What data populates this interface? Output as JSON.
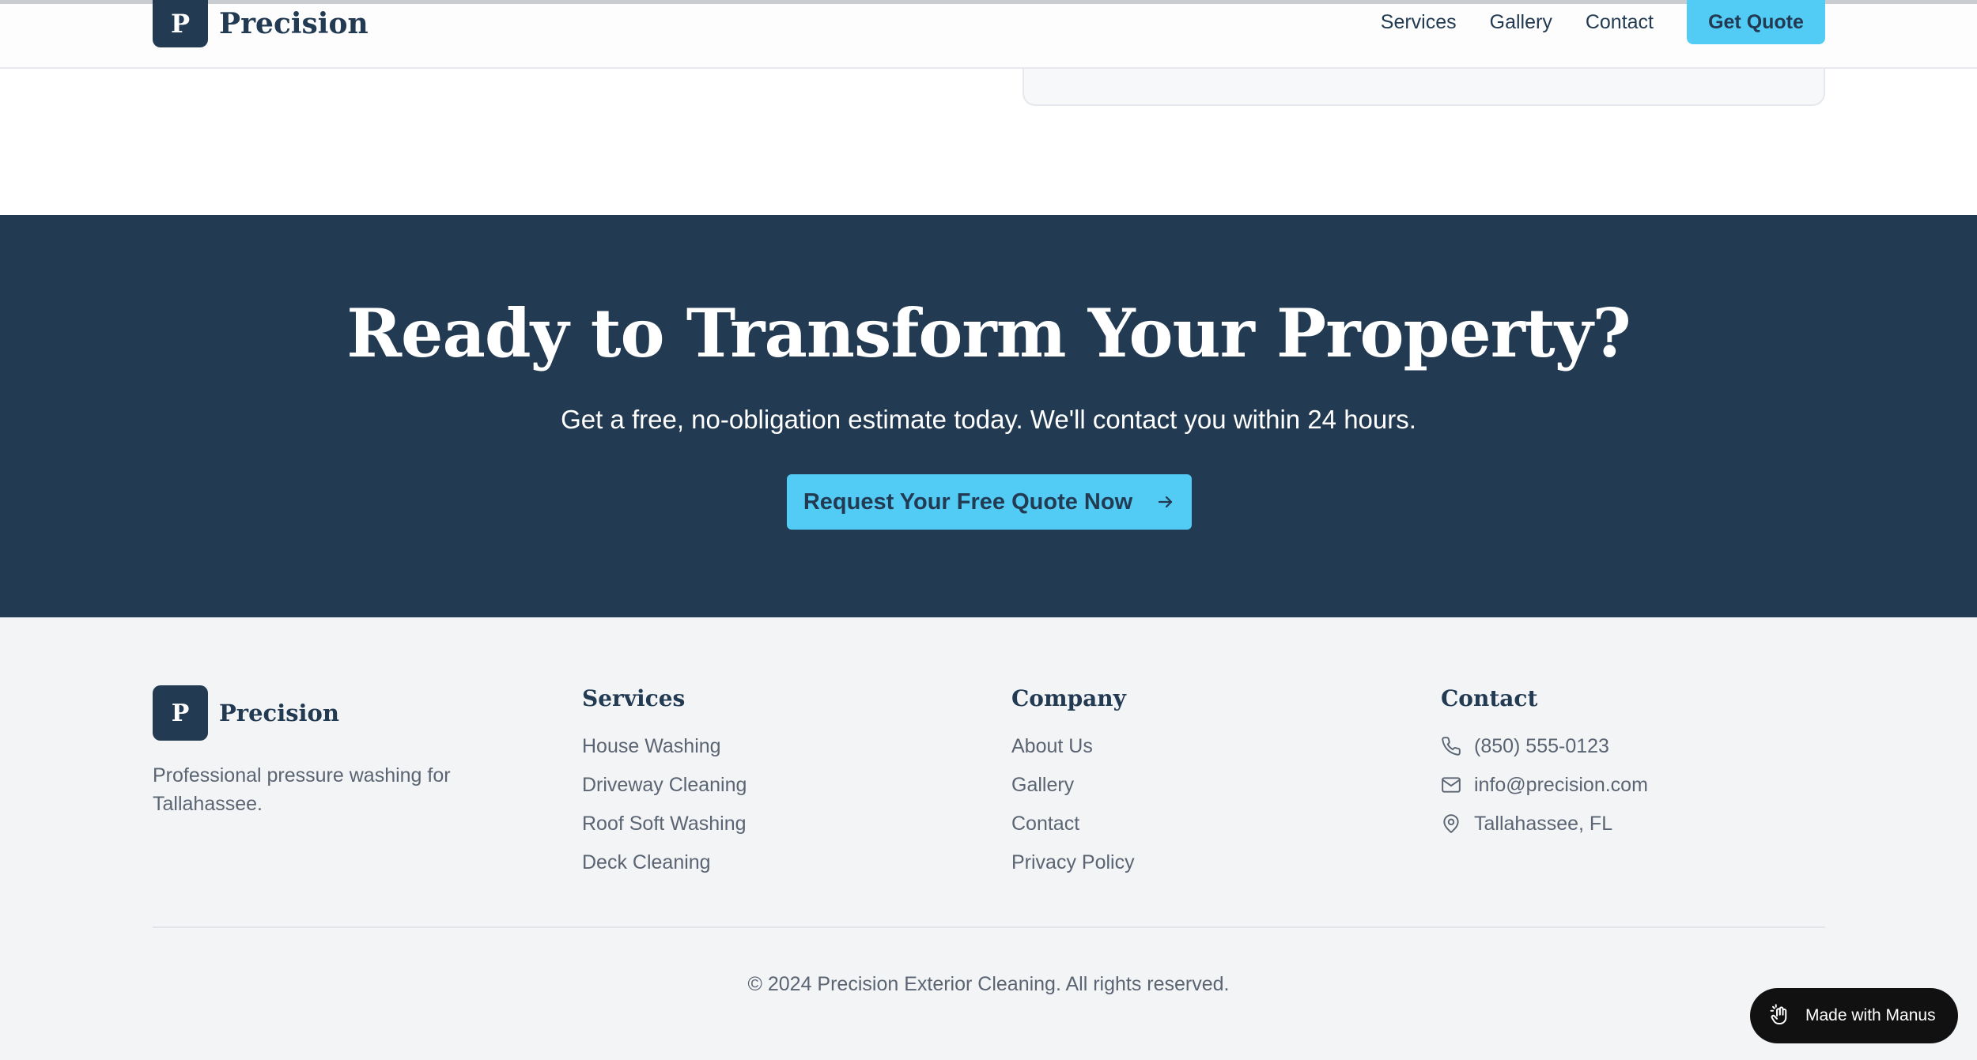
{
  "header": {
    "logo_letter": "P",
    "brand_name": "Precision",
    "nav": {
      "services": "Services",
      "gallery": "Gallery",
      "contact": "Contact",
      "cta": "Get Quote"
    }
  },
  "cta_section": {
    "title": "Ready to Transform Your Property?",
    "subtitle": "Get a free, no-obligation estimate today. We'll contact you within 24 hours.",
    "button_label": "Request Your Free Quote Now",
    "button_icon": "arrow-right-icon"
  },
  "footer": {
    "logo_letter": "P",
    "brand_name": "Precision",
    "tagline": "Professional pressure washing for Tallahassee.",
    "services": {
      "heading": "Services",
      "items": [
        "House Washing",
        "Driveway Cleaning",
        "Roof Soft Washing",
        "Deck Cleaning"
      ]
    },
    "company": {
      "heading": "Company",
      "items": [
        "About Us",
        "Gallery",
        "Contact",
        "Privacy Policy"
      ]
    },
    "contact": {
      "heading": "Contact",
      "phone": "(850) 555-0123",
      "email": "info@precision.com",
      "location": "Tallahassee, FL"
    },
    "copyright": "© 2024 Precision Exterior Cleaning. All rights reserved."
  },
  "badge": {
    "label": "Made with Manus",
    "icon": "manus-hand-icon"
  },
  "colors": {
    "navy": "#223a52",
    "accent": "#52cbf5",
    "footer_bg": "#f3f4f6",
    "muted_text": "#5a6472"
  }
}
